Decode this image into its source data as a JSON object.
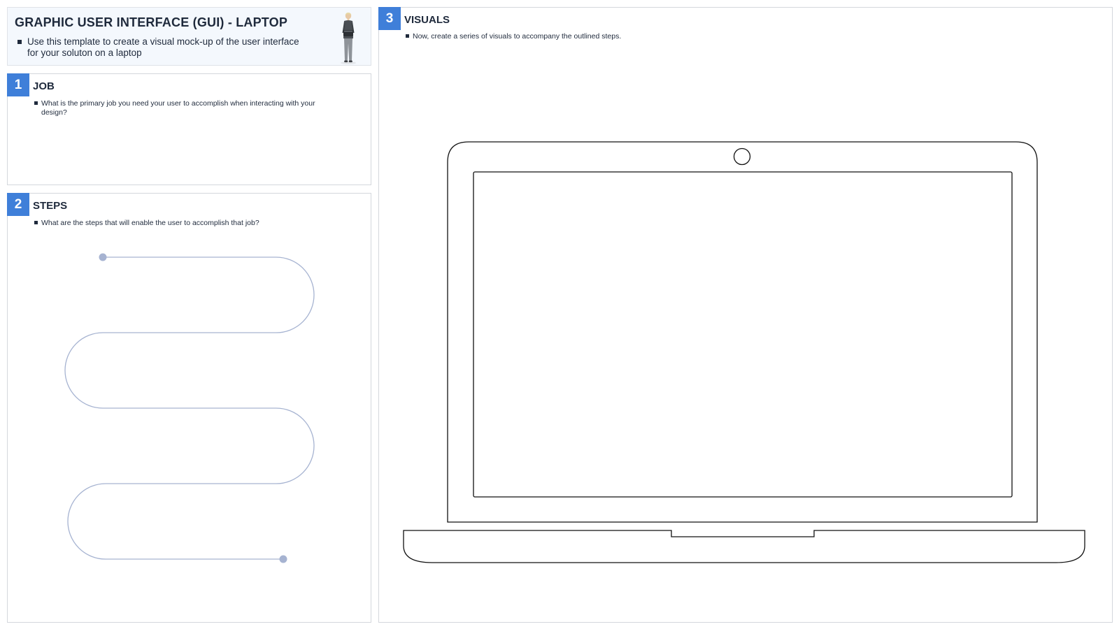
{
  "header": {
    "title": "GRAPHIC USER INTERFACE (GUI) - LAPTOP",
    "intro": "Use this template to create a visual mock-up of the user interface for your soluton on a laptop"
  },
  "sections": [
    {
      "number": "1",
      "title": "JOB",
      "prompt": "What is the primary job you need your user to accomplish when interacting with your design?"
    },
    {
      "number": "2",
      "title": "STEPS",
      "prompt": "What are the steps that will enable the user to accomplish that job?"
    },
    {
      "number": "3",
      "title": "VISUALS",
      "prompt": "Now, create a series of visuals to accompany the outlined steps."
    }
  ],
  "colors": {
    "accent": "#3f7fd9",
    "path": "#a6b3d1",
    "text": "#1f2a3c",
    "border": "#d4d7dc",
    "header_bg": "#f4f8fd"
  },
  "icons": {
    "person": "person-figure-icon",
    "laptop": "laptop-outline-icon"
  }
}
